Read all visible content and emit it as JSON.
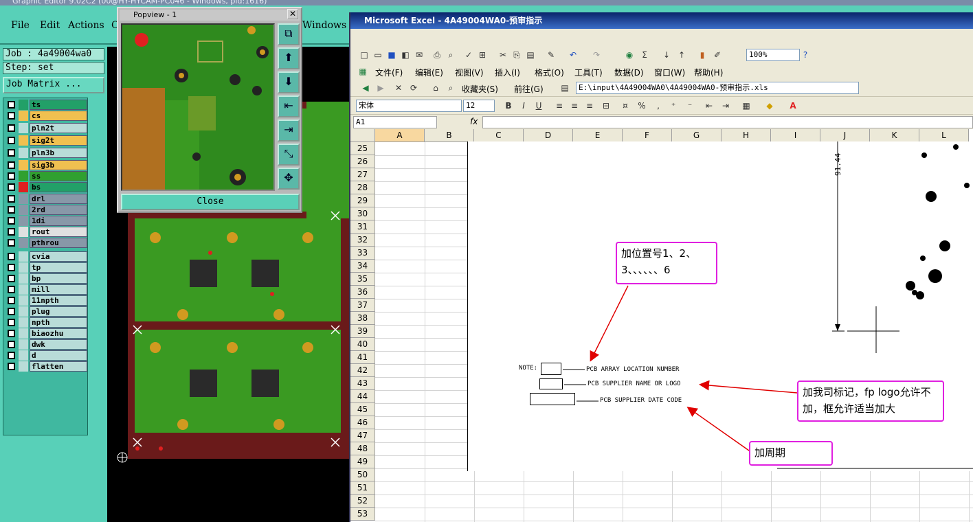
{
  "graphic_editor": {
    "title": "Graphic Editor 9.02C2 (00@HY-HYCAM-PC046 - Windows, pid:1616)",
    "menus": [
      "File",
      "Edit",
      "Actions",
      "C",
      "Windows"
    ],
    "job": "Job : 4a49004wa0",
    "step": "Step: set",
    "job_matrix": "Job Matrix ...",
    "layers": [
      {
        "name": "ts",
        "color": "#22a068"
      },
      {
        "name": "cs",
        "color": "#f0c050"
      },
      {
        "name": "pln2t",
        "color": "#b8dcd8"
      },
      {
        "name": "sig2t",
        "color": "#f0c050"
      },
      {
        "name": "pln3b",
        "color": "#b8dcd8"
      },
      {
        "name": "sig3b",
        "color": "#f0c050"
      },
      {
        "name": "ss",
        "color": "#30a030"
      },
      {
        "name": "bs",
        "color": "#22a068"
      },
      {
        "name": "drl",
        "color": "#8898a8"
      },
      {
        "name": "2rd",
        "color": "#8898a8"
      },
      {
        "name": "1di",
        "color": "#8898a8"
      },
      {
        "name": "rout",
        "color": "#e0e0e0"
      },
      {
        "name": "pthrou",
        "color": "#8898a8"
      },
      {
        "name": "cvia",
        "color": "#b8dcd8"
      },
      {
        "name": "tp",
        "color": "#b8dcd8"
      },
      {
        "name": "bp",
        "color": "#b8dcd8"
      },
      {
        "name": "mill",
        "color": "#b8dcd8"
      },
      {
        "name": "11npth",
        "color": "#b8dcd8"
      },
      {
        "name": "plug",
        "color": "#b8dcd8"
      },
      {
        "name": "npth",
        "color": "#b8dcd8"
      },
      {
        "name": "biaozhu",
        "color": "#b8dcd8"
      },
      {
        "name": "dwk",
        "color": "#b8dcd8"
      },
      {
        "name": "d",
        "color": "#b8dcd8"
      },
      {
        "name": "flatten",
        "color": "#b8dcd8"
      }
    ]
  },
  "popview": {
    "title": "Popview - 1",
    "close_label": "Close"
  },
  "excel": {
    "title": "Microsoft Excel - 4A49004WA0-预审指示",
    "menus": [
      "文件(F)",
      "编辑(E)",
      "视图(V)",
      "插入(I)",
      "格式(O)",
      "工具(T)",
      "数据(D)",
      "窗口(W)",
      "帮助(H)"
    ],
    "zoom": "100%",
    "favorites": "收藏夹(S)",
    "go": "前往(G)",
    "path": "E:\\input\\4A49004WA0\\4A49004WA0-预审指示.xls",
    "font": "宋体",
    "font_size": "12",
    "name_box": "A1",
    "fx": "fx",
    "columns": [
      "A",
      "B",
      "C",
      "D",
      "E",
      "F",
      "G",
      "H",
      "I",
      "J",
      "K",
      "L"
    ],
    "rows": [
      "25",
      "26",
      "27",
      "28",
      "29",
      "30",
      "31",
      "32",
      "33",
      "34",
      "35",
      "36",
      "37",
      "38",
      "39",
      "40",
      "41",
      "42",
      "43",
      "44",
      "45",
      "46",
      "47",
      "48",
      "49",
      "50",
      "51",
      "52",
      "53"
    ]
  },
  "drawing": {
    "dimension": "91.44",
    "note_label": "NOTE:",
    "note_lines": [
      "PCB ARRAY LOCATION NUMBER",
      "PCB SUPPLIER NAME OR LOGO",
      "PCB SUPPLIER DATE CODE"
    ],
    "callouts": [
      "加位置号1、2、3、、、、、、6",
      "加我司标记，fp logo允许不加，框允许适当加大",
      "加周期"
    ]
  }
}
